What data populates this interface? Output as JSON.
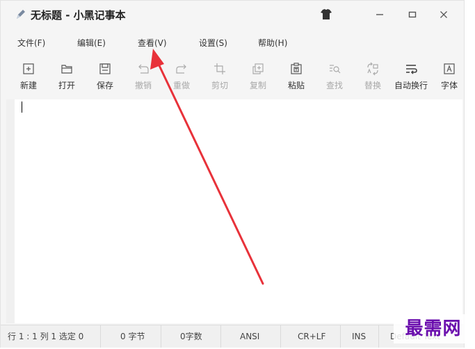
{
  "window": {
    "title": "无标题 - 小黑记事本"
  },
  "menu": {
    "file": "文件(F)",
    "edit": "编辑(E)",
    "view": "查看(V)",
    "settings": "设置(S)",
    "help": "帮助(H)"
  },
  "toolbar": {
    "new": "新建",
    "open": "打开",
    "save": "保存",
    "undo": "撤销",
    "redo": "重做",
    "cut": "剪切",
    "copy": "复制",
    "paste": "粘贴",
    "find": "查找",
    "replace": "替换",
    "wrap": "自动换行",
    "font": "字体"
  },
  "status": {
    "position": "行 1 : 1   列 1   选定 0",
    "bytes": "0 字节",
    "chars": "0字数",
    "encoding": "ANSI",
    "line_ending": "CR+LF",
    "insert_mode": "INS",
    "syntax": "Default Text"
  },
  "watermark": "最需网",
  "colors": {
    "annotation_arrow": "#e8323a",
    "watermark": "#6a0dad",
    "disabled_text": "#a8a8a8"
  }
}
